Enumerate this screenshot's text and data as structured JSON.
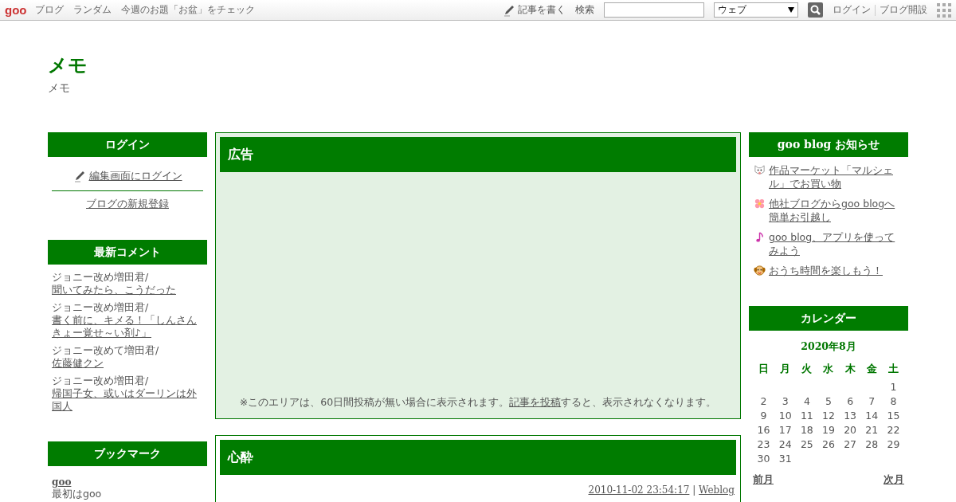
{
  "topbar": {
    "logo": "goo",
    "links": [
      "ブログ",
      "ランダム",
      "今週のお題「お盆」をチェック"
    ],
    "write": "記事を書く",
    "search_label": "検索",
    "search_scope": "ウェブ",
    "login": "ログイン",
    "open_blog": "ブログ開設"
  },
  "blog": {
    "title": "メモ",
    "subtitle": "メモ"
  },
  "left": {
    "login": {
      "heading": "ログイン",
      "edit_login": "編集画面にログイン",
      "register": "ブログの新規登録"
    },
    "comments": {
      "heading": "最新コメント",
      "items": [
        {
          "author": "ジョニー改め増田君/",
          "title": "聞いてみたら、こうだった"
        },
        {
          "author": "ジョニー改め増田君/",
          "title": "書く前に、キメる！「しんさんきょー覚せ～い剤♪」"
        },
        {
          "author": "ジョニー改めて増田君/",
          "title": "佐藤健クン"
        },
        {
          "author": "ジョニー改め増田君/",
          "title": "帰国子女、或いはダーリンは外国人"
        }
      ]
    },
    "bookmarks": {
      "heading": "ブックマーク",
      "items": [
        {
          "name": "goo",
          "description": "最初はgoo"
        }
      ]
    }
  },
  "ad": {
    "heading": "広告",
    "notice_before": "※このエリアは、60日間投稿が無い場合に表示されます。",
    "notice_link": "記事を投稿",
    "notice_after": "すると、表示されなくなります。"
  },
  "post": {
    "title": "心酔",
    "date": "2010-11-02 23:54:17",
    "separator": "|",
    "category": "Weblog"
  },
  "right": {
    "news": {
      "heading": "goo blog お知らせ",
      "items": [
        {
          "kind": "cat",
          "text": "作品マーケット「マルシェル」でお買い物"
        },
        {
          "kind": "flower",
          "text": "他社ブログからgoo blogへ簡単お引越し"
        },
        {
          "kind": "note",
          "text": "goo blog、アプリを使ってみよう"
        },
        {
          "kind": "dog",
          "text": "おうち時間を楽しもう！"
        }
      ]
    },
    "calendar": {
      "heading": "カレンダー",
      "month": "2020年8月",
      "weekdays": [
        "日",
        "月",
        "火",
        "水",
        "木",
        "金",
        "土"
      ],
      "weeks": [
        {
          "kind": "first",
          "days": [
            "1"
          ]
        },
        {
          "kind": "full",
          "days": [
            "2",
            "3",
            "4",
            "5",
            "6",
            "7",
            "8"
          ]
        },
        {
          "kind": "full",
          "days": [
            "9",
            "10",
            "11",
            "12",
            "13",
            "14",
            "15"
          ]
        },
        {
          "kind": "full",
          "days": [
            "16",
            "17",
            "18",
            "19",
            "20",
            "21",
            "22"
          ]
        },
        {
          "kind": "full",
          "days": [
            "23",
            "24",
            "25",
            "26",
            "27",
            "28",
            "29"
          ]
        },
        {
          "kind": "last",
          "days": [
            "30",
            "31"
          ]
        }
      ],
      "prev": "前月",
      "next": "次月"
    }
  }
}
